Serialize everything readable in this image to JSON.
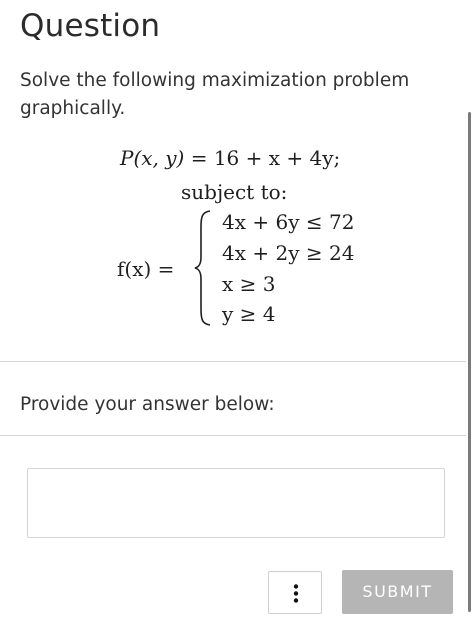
{
  "question": {
    "heading": "Question",
    "prompt": "Solve the following maximization problem graphically."
  },
  "math": {
    "objective": {
      "lhs": "P(x, y)",
      "rhs": "= 16 + x + 4y;"
    },
    "subject_to": "subject to:",
    "function_label": "f(x) =",
    "constraints": [
      "4x + 6y ≤ 72",
      "4x + 2y ≥ 24",
      "x ≥ 3",
      "y ≥ 4"
    ]
  },
  "answer": {
    "label": "Provide your answer below:",
    "value": ""
  },
  "actions": {
    "more_icon": "vertical-ellipsis-icon",
    "submit_label": "SUBMIT"
  },
  "colors": {
    "submit_disabled": "#b5b5b5",
    "divider": "#d6d6d6"
  }
}
